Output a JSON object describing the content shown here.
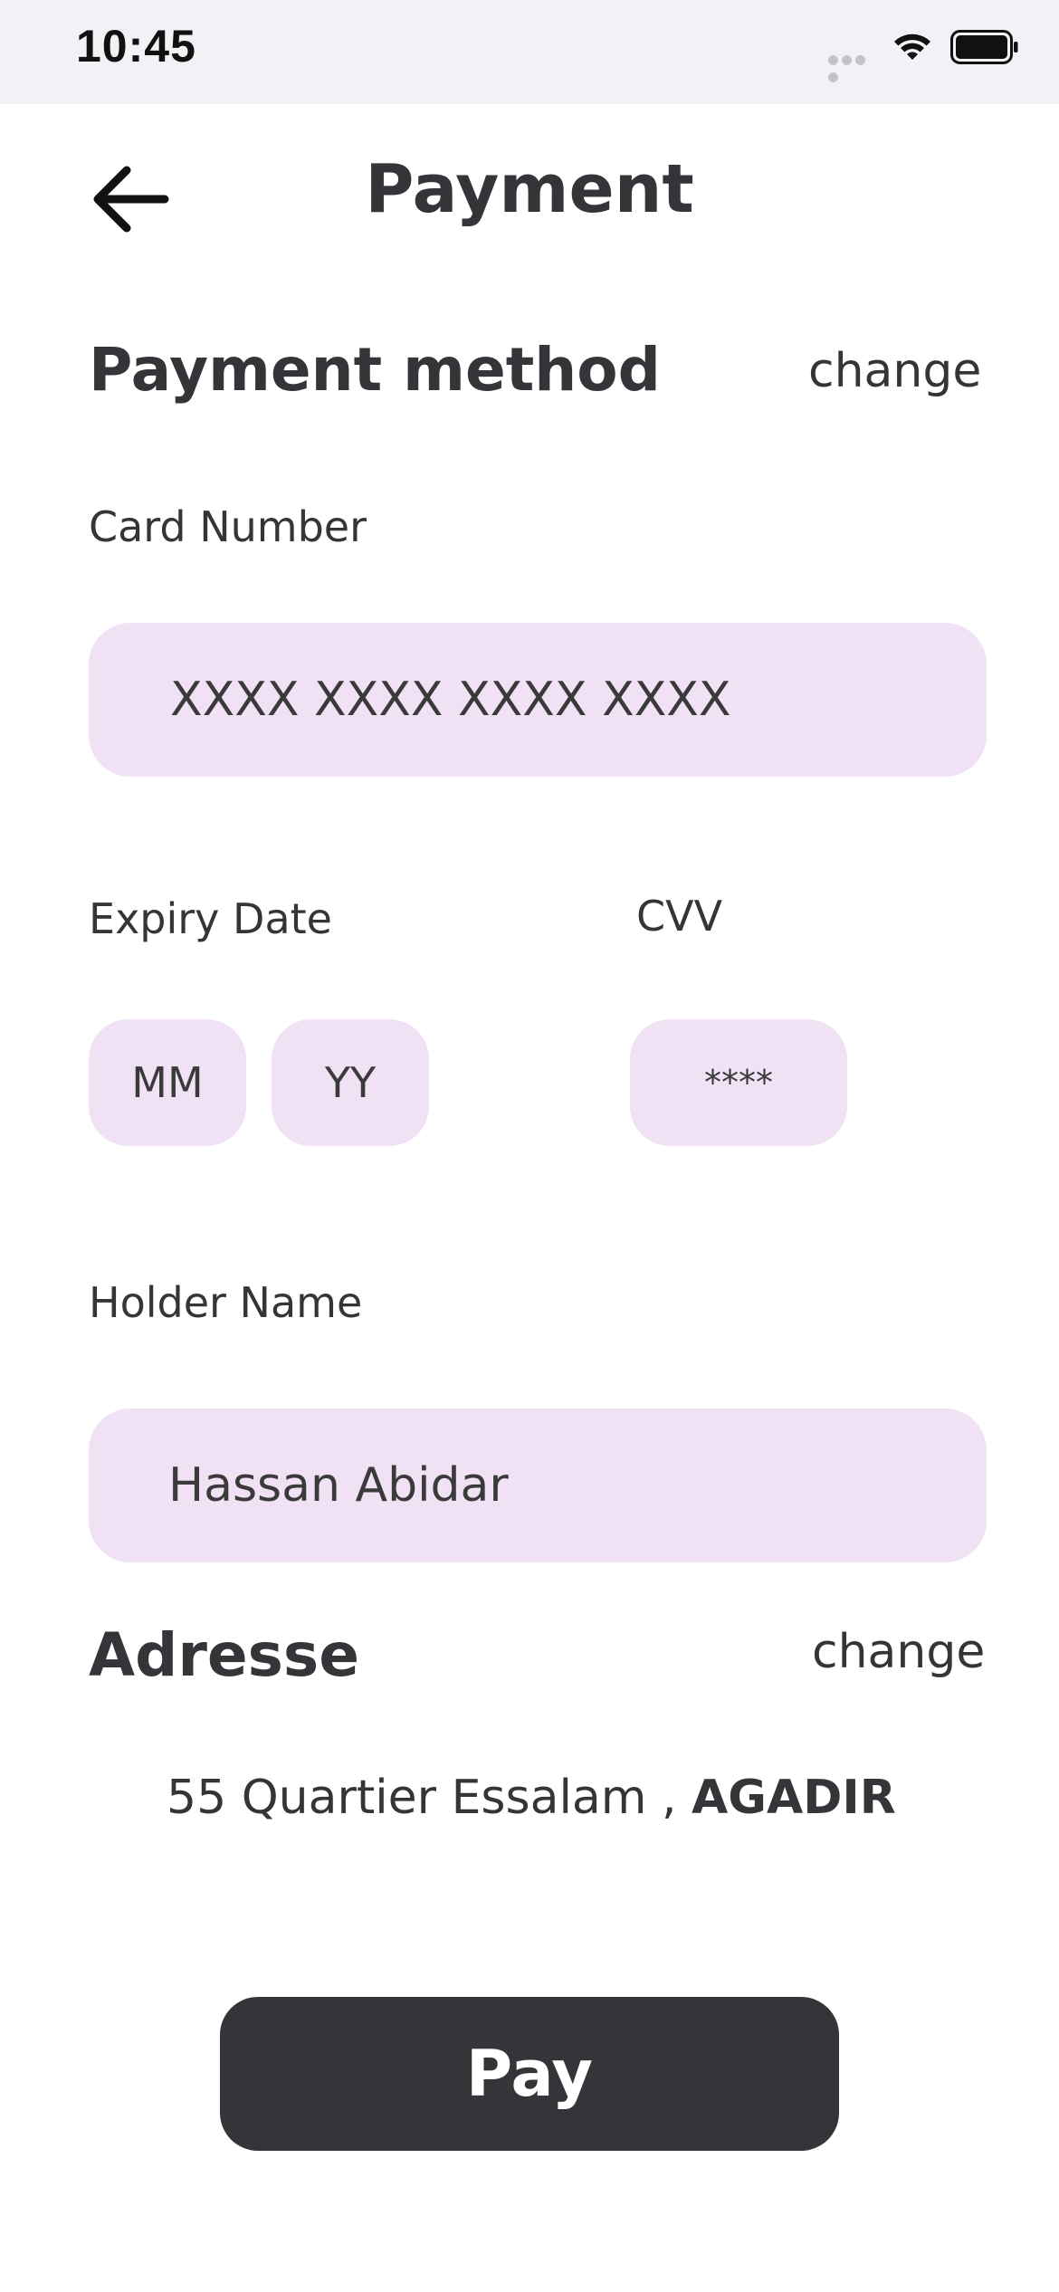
{
  "status_bar": {
    "time": "10:45",
    "wifi_icon": "wifi-icon",
    "battery_icon": "battery-icon"
  },
  "header": {
    "back_icon": "arrow-left-icon",
    "title": "Payment"
  },
  "payment_method": {
    "heading": "Payment method",
    "change_label": "change",
    "card_number": {
      "label": "Card Number",
      "placeholder": "XXXX XXXX XXXX XXXX",
      "value": ""
    },
    "expiry": {
      "label": "Expiry Date",
      "month_placeholder": "MM",
      "year_placeholder": "YY"
    },
    "cvv": {
      "label": "CVV",
      "placeholder": "****"
    },
    "holder": {
      "label": "Holder Name",
      "value": "Hassan Abidar"
    }
  },
  "address": {
    "heading": "Adresse",
    "change_label": "change",
    "street": "55 Quartier Essalam ,",
    "city": "AGADIR"
  },
  "pay_button": {
    "label": "Pay"
  },
  "colors": {
    "field_background": "#f0e1f4",
    "text": "#343538",
    "button_background": "#333538",
    "status_bar_background": "#f2f1f6"
  }
}
